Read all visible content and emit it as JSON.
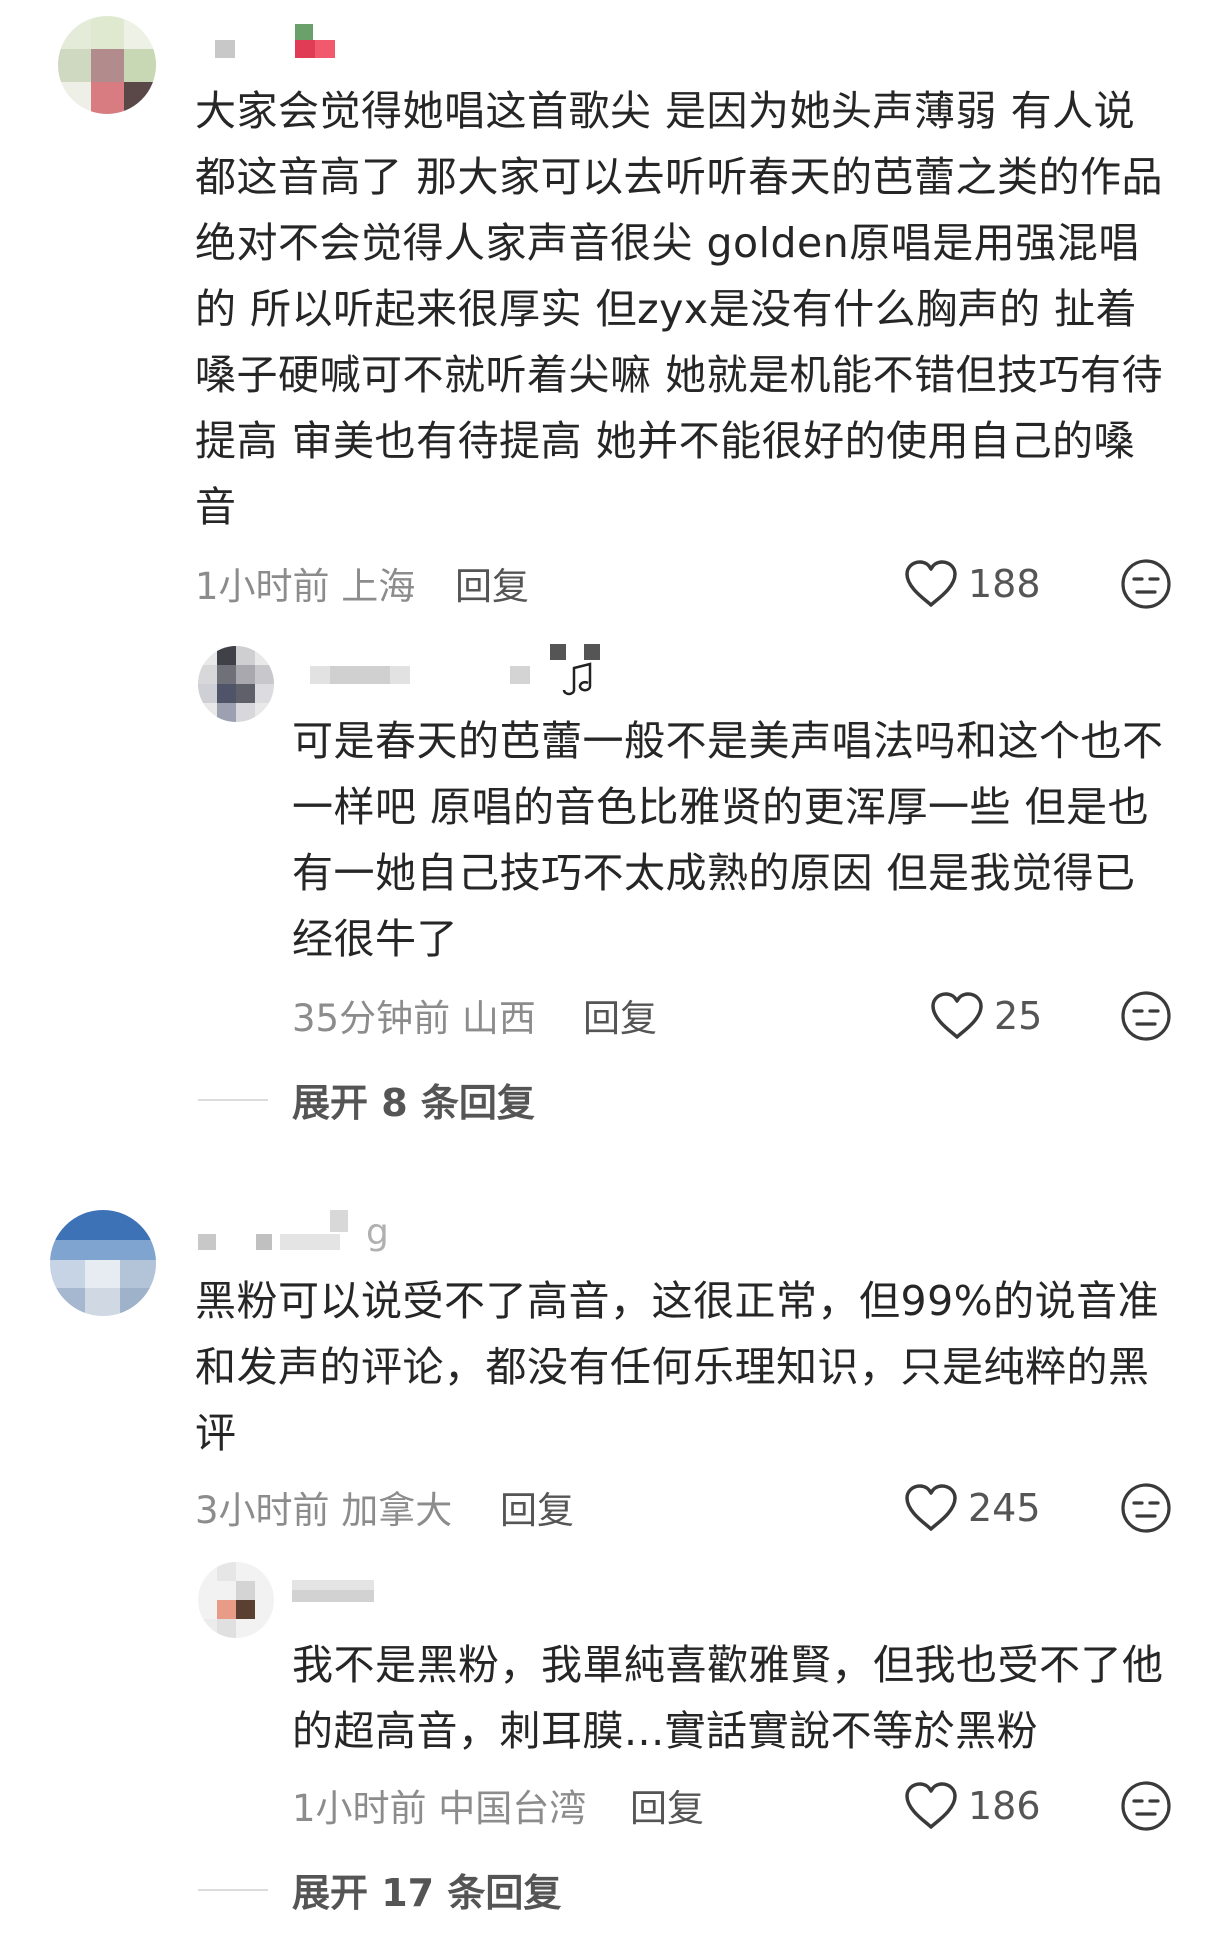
{
  "comments": [
    {
      "text": "大家会觉得她唱这首歌尖 是因为她头声薄弱 有人说都这音高了 那大家可以去听听春天的芭蕾之类的作品 绝对不会觉得人家声音很尖 golden原唱是用强混唱的 所以听起来很厚实 但zyx是没有什么胸声的 扯着嗓子硬喊可不就听着尖嘛 她就是机能不错但技巧有待提高 审美也有待提高 她并不能很好的使用自己的嗓音",
      "meta": "1小时前 上海",
      "reply_label": "回复",
      "likes": "188",
      "icons": {
        "like": "heart-icon",
        "dislike": "dislike-face-icon"
      },
      "replies": [
        {
          "text": "可是春天的芭蕾一般不是美声唱法吗和这个也不一样吧 原唱的音色比雅贤的更浑厚一些 但是也有一她自己技巧不太成熟的原因 但是我觉得已经很牛了",
          "meta": "35分钟前 山西",
          "reply_label": "回复",
          "likes": "25"
        }
      ],
      "expand_label": "展开 8 条回复"
    },
    {
      "username_partial": "g",
      "text": "黑粉可以说受不了高音，这很正常，但99%的说音准和发声的评论，都没有任何乐理知识，只是纯粹的黑评",
      "meta": "3小时前 加拿大",
      "reply_label": "回复",
      "likes": "245",
      "replies": [
        {
          "text": "我不是黑粉，我單純喜歡雅賢，但我也受不了他的超高音，刺耳膜...實話實說不等於黑粉",
          "meta": "1小时前 中国台湾",
          "reply_label": "回复",
          "likes": "186"
        }
      ],
      "expand_label": "展开 17 条回复"
    }
  ],
  "colors": {
    "text": "#262626",
    "meta": "#8c8c8c",
    "action": "#555555"
  }
}
